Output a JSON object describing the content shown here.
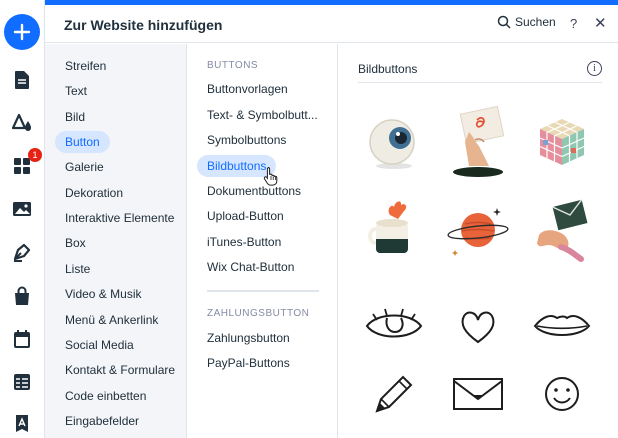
{
  "header": {
    "title": "Zur Website hinzufügen",
    "search_label": "Suchen",
    "help_label": "?",
    "close_label": "✕"
  },
  "toolbar": {
    "add_label": "+",
    "notification_count": "1",
    "icons": [
      "add-icon",
      "pages-icon",
      "design-icon",
      "apps-icon",
      "media-icon",
      "blog-icon",
      "store-icon",
      "bookings-icon",
      "cms-icon",
      "text-style-icon"
    ]
  },
  "categories": [
    {
      "label": "Streifen"
    },
    {
      "label": "Text"
    },
    {
      "label": "Bild"
    },
    {
      "label": "Button"
    },
    {
      "label": "Galerie"
    },
    {
      "label": "Dekoration"
    },
    {
      "label": "Interaktive Elemente"
    },
    {
      "label": "Box"
    },
    {
      "label": "Liste"
    },
    {
      "label": "Video & Musik"
    },
    {
      "label": "Menü & Ankerlink"
    },
    {
      "label": "Social Media"
    },
    {
      "label": "Kontakt & Formulare"
    },
    {
      "label": "Code einbetten"
    },
    {
      "label": "Eingabefelder"
    }
  ],
  "active_category": "Button",
  "buttons_section": {
    "heading": "BUTTONS",
    "items": [
      {
        "label": "Buttonvorlagen"
      },
      {
        "label": "Text- & Symbolbutt..."
      },
      {
        "label": "Symbolbuttons"
      },
      {
        "label": "Bildbuttons"
      },
      {
        "label": "Dokumentbuttons"
      },
      {
        "label": "Upload-Button"
      },
      {
        "label": "iTunes-Button"
      },
      {
        "label": "Wix Chat-Button"
      }
    ]
  },
  "payment_section": {
    "heading": "ZAHLUNGSBUTTON",
    "items": [
      {
        "label": "Zahlungsbutton"
      },
      {
        "label": "PayPal-Buttons"
      }
    ]
  },
  "active_sub": "Bildbuttons",
  "content": {
    "title": "Bildbuttons",
    "info_label": "i",
    "items": [
      "eyeball",
      "hand-holding-card",
      "rubiks-cube",
      "mug",
      "planet",
      "envelope-hand",
      "eye-sketch",
      "heart-sketch",
      "lips-sketch",
      "pencil-sketch",
      "envelope-sketch",
      "smiley-sketch"
    ]
  },
  "colors": {
    "accent": "#116dff",
    "active_bg": "#d6e6fe",
    "badge": "#e62214",
    "text": "#20303c",
    "muted": "#868aa5"
  }
}
